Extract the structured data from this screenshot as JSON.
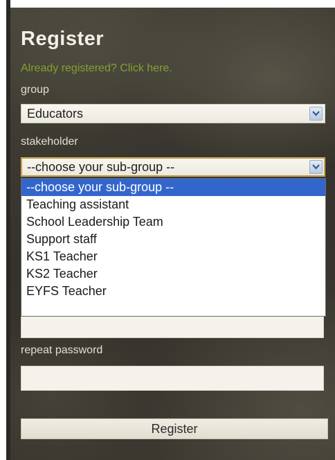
{
  "form": {
    "title": "Register",
    "login_link": "Already registered? Click here.",
    "group_label": "group",
    "group_value": "Educators",
    "stakeholder_label": "stakeholder",
    "stakeholder_value": "--choose your sub-group --",
    "stakeholder_options": [
      "--choose your sub-group --",
      "Teaching assistant",
      "School Leadership Team",
      "Support staff",
      "KS1 Teacher",
      "KS2 Teacher",
      "EYFS Teacher"
    ],
    "selected_option_index": 0,
    "repeat_password_label": "repeat password",
    "register_button": "Register"
  },
  "colors": {
    "link": "#86a030",
    "option_highlight": "#3366cc",
    "panel_bg": "#3d3a32"
  }
}
